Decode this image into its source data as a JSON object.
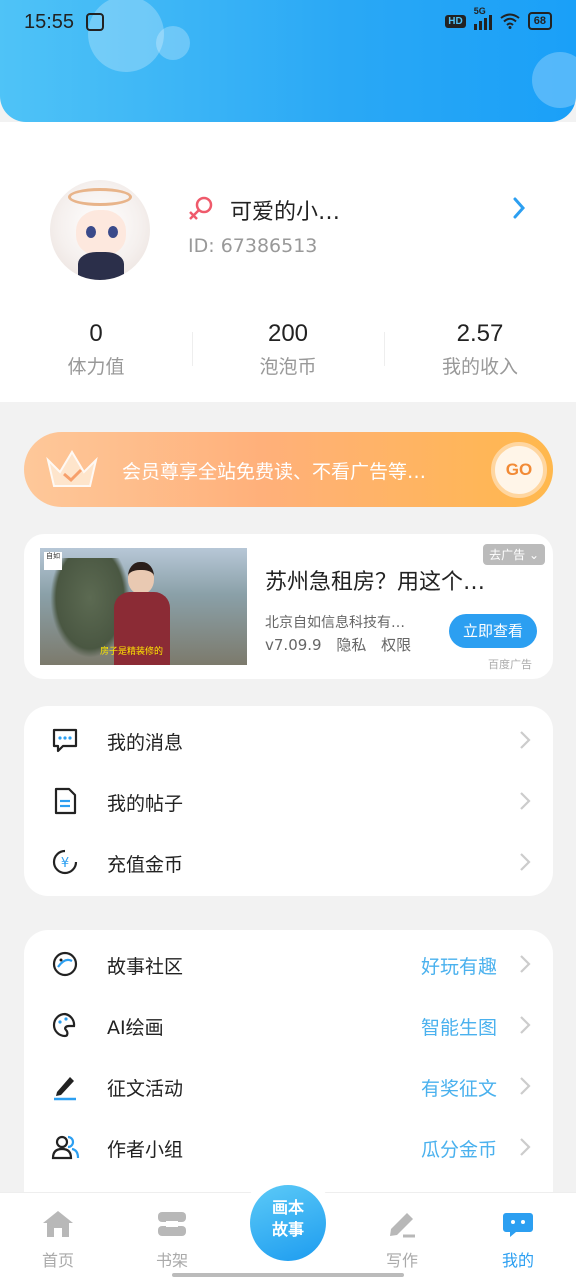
{
  "status_bar": {
    "time": "15:55",
    "network": "5G",
    "hd": "HD",
    "battery": "68"
  },
  "profile": {
    "nickname": "可爱的小…",
    "id_label": "ID:",
    "id_value": "67386513"
  },
  "stats": [
    {
      "value": "0",
      "label": "体力值"
    },
    {
      "value": "200",
      "label": "泡泡币"
    },
    {
      "value": "2.57",
      "label": "我的收入"
    }
  ],
  "vip_banner": {
    "text": "会员尊享全站免费读、不看广告等…",
    "go_label": "GO"
  },
  "ad": {
    "tag": "去广告",
    "title": "苏州急租房？用这个…",
    "company": "北京自如信息科技有…",
    "version": "v7.09.9",
    "privacy": "隐私",
    "permission": "权限",
    "cta": "立即查看",
    "source": "百度广告",
    "photo_caption": "房子是精装修的",
    "photo_logo": "自如"
  },
  "menu_primary": [
    {
      "label": "我的消息",
      "icon": "message-icon"
    },
    {
      "label": "我的帖子",
      "icon": "document-icon"
    },
    {
      "label": "充值金币",
      "icon": "yuan-coin-icon"
    }
  ],
  "menu_secondary": [
    {
      "label": "故事社区",
      "hint": "好玩有趣",
      "icon": "planet-icon"
    },
    {
      "label": "AI绘画",
      "hint": "智能生图",
      "icon": "palette-icon"
    },
    {
      "label": "征文活动",
      "hint": "有奖征文",
      "icon": "pen-icon"
    },
    {
      "label": "作者小组",
      "hint": "瓜分金币",
      "icon": "group-icon"
    }
  ],
  "nav": {
    "home": "首页",
    "shelf": "书架",
    "center_line1": "画本",
    "center_line2": "故事",
    "write": "写作",
    "mine": "我的"
  },
  "colors": {
    "accent": "#2c9ff1",
    "hint": "#4ab1ee",
    "vip_start": "#fec89a",
    "vip_end": "#ffb84d"
  }
}
